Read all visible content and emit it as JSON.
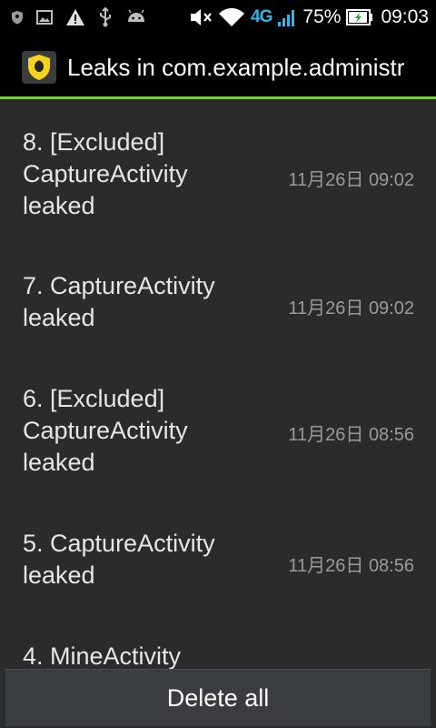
{
  "status_bar": {
    "network_label": "4G",
    "battery_percent": "75%",
    "clock": "09:03",
    "icons": [
      "shield-icon",
      "image-icon",
      "warning-icon",
      "usb-icon",
      "android-icon",
      "mute-icon",
      "wifi-icon",
      "signal-icon",
      "battery-charging-icon"
    ]
  },
  "action_bar": {
    "title": "Leaks in com.example.administr",
    "app_icon": "leak-canary-icon"
  },
  "colors": {
    "accent": "#7ecb3b",
    "network": "#33b5e5",
    "background": "#2b2b2b"
  },
  "leaks": [
    {
      "title": "8. [Excluded] CaptureActivity leaked",
      "time": "11月26日 09:02"
    },
    {
      "title": "7. CaptureActivity leaked",
      "time": "11月26日 09:02"
    },
    {
      "title": "6. [Excluded] CaptureActivity leaked",
      "time": "11月26日 08:56"
    },
    {
      "title": "5. CaptureActivity leaked",
      "time": "11月26日 08:56"
    },
    {
      "title": "4. MineActivity",
      "time": ""
    }
  ],
  "footer": {
    "delete_all_label": "Delete all"
  }
}
